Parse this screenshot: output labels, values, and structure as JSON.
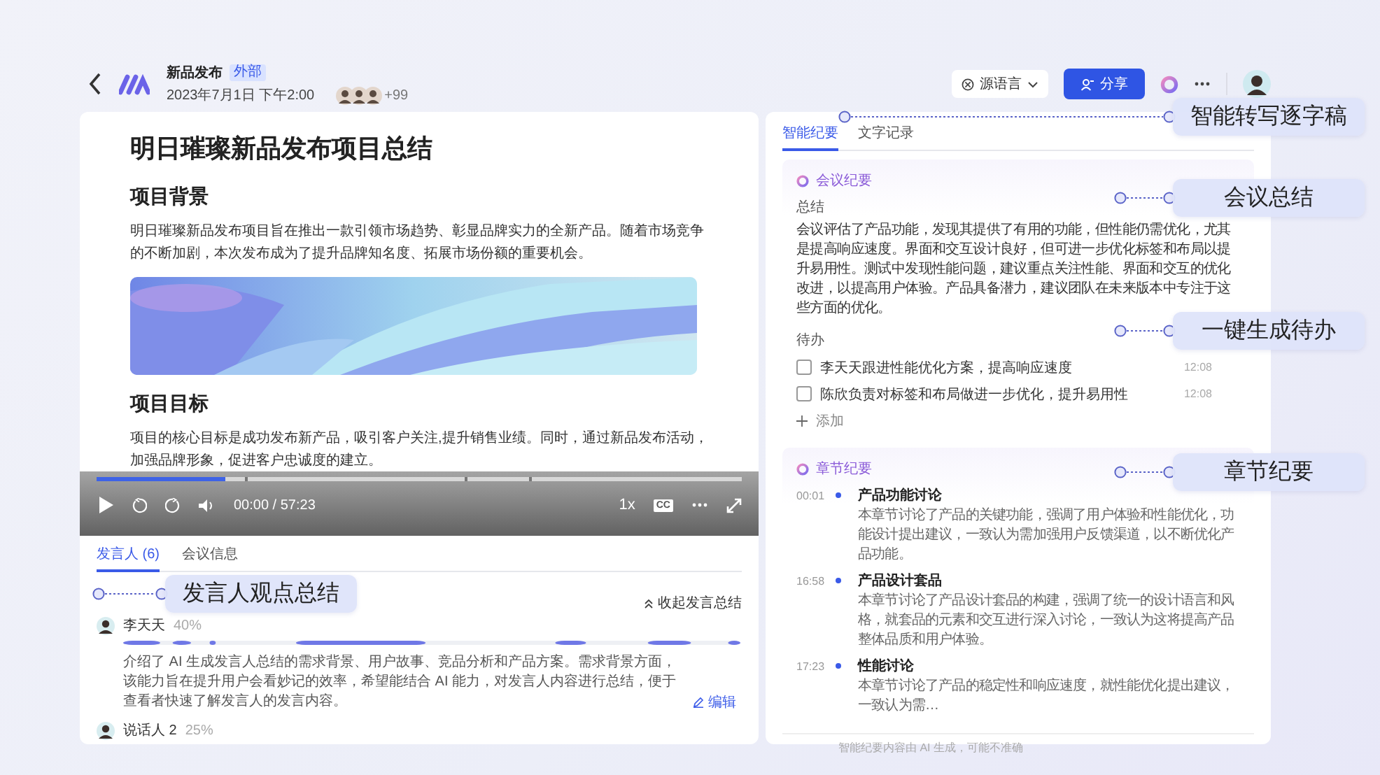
{
  "header": {
    "title": "新品发布",
    "badge": "外部",
    "datetime": "2023年7月1日 下午2:00",
    "participants_more": "+99",
    "language_button": "源语言",
    "share_button": "分享"
  },
  "document": {
    "blocks": [
      {
        "kind": "title",
        "text": "明日璀璨新品发布项目总结"
      },
      {
        "kind": "heading",
        "text": "项目背景"
      },
      {
        "kind": "paragraph",
        "text": "明日璀璨新品发布项目旨在推出一款引领市场趋势、彰显品牌实力的全新产品。随着市场竞争的不断加剧，本次发布成为了提升品牌知名度、拓展市场份额的重要机会。"
      },
      {
        "kind": "picture"
      },
      {
        "kind": "heading",
        "text": "项目目标"
      },
      {
        "kind": "paragraph",
        "text": "项目的核心目标是成功发布新产品，吸引客户关注,提升销售业绩。同时，通过新品发布活动，加强品牌形象，促进客户忠诚度的建立。"
      }
    ]
  },
  "player": {
    "level": 0.2,
    "time": "00:00 / 57:23",
    "speed": "1x",
    "captions": "CC"
  },
  "speaker_panel": {
    "tabs": [
      {
        "label": "发言人 (6)",
        "selected": true
      },
      {
        "label": "会议信息",
        "selected": false
      }
    ],
    "collapse_link": "收起发言总结",
    "speakers": [
      {
        "name": "李天天",
        "share": "40%",
        "summary": "介绍了 AI 生成发言人总结的需求背景、用户故事、竞品分析和产品方案。需求背景方面，该能力旨在提升用户会看妙记的效率，希望能结合 AI 能力，对发言人内容进行总结，便于查看者快速了解发言人的发言内容。",
        "edit_link": "编辑"
      },
      {
        "name": "说话人 2",
        "share": "25%"
      }
    ]
  },
  "summary_panel": {
    "tabs": [
      {
        "label": "智能纪要",
        "selected": true
      },
      {
        "label": "文字记录",
        "selected": false
      }
    ],
    "minutes": {
      "title": "会议纪要",
      "summary_label": "总结",
      "summary": "会议评估了产品功能，发现其提供了有用的功能，但性能仍需优化，尤其是提高响应速度。界面和交互设计良好，但可进一步优化标签和布局以提升易用性。测试中发现性能问题，建议重点关注性能、界面和交互的优化改进，以提高用户体验。产品具备潜力，建议团队在未来版本中专注于这些方面的优化。",
      "todo_label": "待办",
      "todos": [
        {
          "text": "李天天跟进性能优化方案，提高响应速度",
          "time": "12:08",
          "checked": false
        },
        {
          "text": "陈欣负责对标签和布局做进一步优化，提升易用性",
          "time": "12:08",
          "checked": false
        }
      ],
      "add_button": "添加"
    },
    "chapters": {
      "title": "章节纪要",
      "items": [
        {
          "time": "00:01",
          "title": "产品功能讨论",
          "text": "本章节讨论了产品的关键功能，强调了用户体验和性能优化，功能设计提出建议，一致认为需加强用户反馈渠道，以不断优化产品功能。"
        },
        {
          "time": "16:58",
          "title": "产品设计套品",
          "text": "本章节讨论了产品设计套品的构建，强调了统一的设计语言和风格，就套品的元素和交互进行深入讨论，一致认为这将提高产品整体品质和用户体验。"
        },
        {
          "time": "17:23",
          "title": "性能讨论",
          "text": "本章节讨论了产品的稳定性和响应速度，就性能优化提出建议，一致认为需…"
        }
      ]
    },
    "footer": "智能纪要内容由 AI 生成，可能不准确"
  },
  "callouts": [
    {
      "text": "发言人观点总结"
    },
    {
      "text": "智能转写逐字稿"
    },
    {
      "text": "会议总结"
    },
    {
      "text": "一键生成待办"
    },
    {
      "text": "章节纪要"
    }
  ]
}
